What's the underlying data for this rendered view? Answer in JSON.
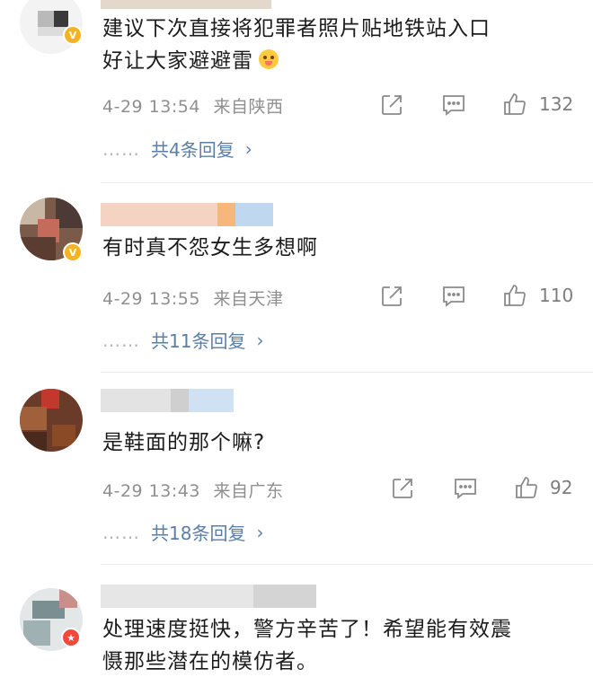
{
  "comments": [
    {
      "text_line1": "建议下次直接将犯罪者照片贴地铁站入口",
      "text_line2": "好让大家避避雷",
      "emoji": "smiling-with-hands-emoji",
      "time": "4-29 13:54",
      "location": "来自陕西",
      "likes": "132",
      "replies": "共4条回复"
    },
    {
      "text": "有时真不怨女生多想啊",
      "time": "4-29 13:55",
      "location": "来自天津",
      "likes": "110",
      "replies": "共11条回复"
    },
    {
      "text": "是鞋面的那个嘛?",
      "time": "4-29 13:43",
      "location": "来自广东",
      "likes": "92",
      "replies": "共18条回复"
    },
    {
      "text_line1": "处理速度挺快，警方辛苦了！希望能有效震",
      "text_line2": "慑那些潜在的模仿者。"
    }
  ],
  "ui": {
    "reply_dots": "……",
    "chevron": "›",
    "verified_badge": "V",
    "official_badge": "★"
  },
  "colors": {
    "link_blue": "#5b7ea6",
    "meta_gray": "#8f8f8f",
    "gold_badge": "#f5b324",
    "red_badge": "#f24a3a"
  }
}
